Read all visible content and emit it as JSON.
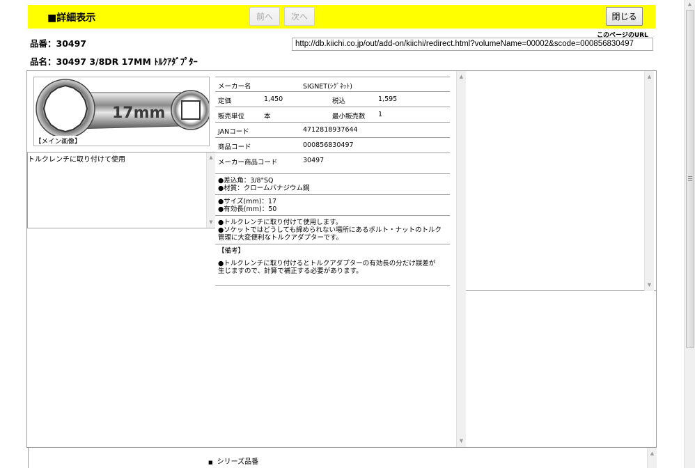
{
  "toolbar": {
    "title": "■詳細表示",
    "prev_label": "前へ",
    "next_label": "次へ",
    "close_label": "閉じる"
  },
  "product": {
    "number_line": "品番：30497",
    "name_line": "品名：30497 3/8DR 17MM ﾄﾙｸｱﾀﾞﾌﾟﾀｰ"
  },
  "page_url": {
    "label": "このページのURL",
    "value": "http://db.kiichi.co.jp/out/add-on/kiichi/redirect.html?volumeName=00002&scode=000856830497"
  },
  "image": {
    "caption": "【メイン画像】",
    "engraving": "17mm"
  },
  "description": "トルクレンチに取り付けて使用",
  "spec": {
    "maker_label": "メーカー名",
    "maker_value": "SIGNET(ｼｸﾞﾈｯﾄ)",
    "list_price_label": "定価",
    "list_price_value": "1,450",
    "tax_incl_label": "税込",
    "tax_incl_value": "1,595",
    "unit_label": "販売単位",
    "unit_value": "本",
    "min_qty_label": "最小販売数",
    "min_qty_value": "1",
    "jan_label": "JANコード",
    "jan_value": "4712818937644",
    "code_label": "商品コード",
    "code_value": "000856830497",
    "maker_code_label": "メーカー商品コード",
    "maker_code_value": "30497"
  },
  "features": {
    "block1_line1": "●差込角：3/8\"SQ",
    "block1_line2": "●材質：クロームバナジウム鋼",
    "block2_line1": "●サイズ(mm)：17",
    "block2_line2": "●有効長(mm)：50",
    "block3_line1": "●トルクレンチに取り付けて使用します。",
    "block3_line2": "●ソケットではどうしても締められない場所にあるボルト・ナットのトルク",
    "block3_line3": "管理に大変便利なトルクアダプターです。",
    "note_heading": "【備考】",
    "note_line1": "●トルクレンチに取り付けるとトルクアダプターの有効長の分だけ誤差が",
    "note_line2": "生じますので、計算で補正する必要があります。"
  },
  "series_label": "シリーズ品番",
  "colors": {
    "toolbar_bg": "#ffff00",
    "border": "#9a9a9a"
  }
}
